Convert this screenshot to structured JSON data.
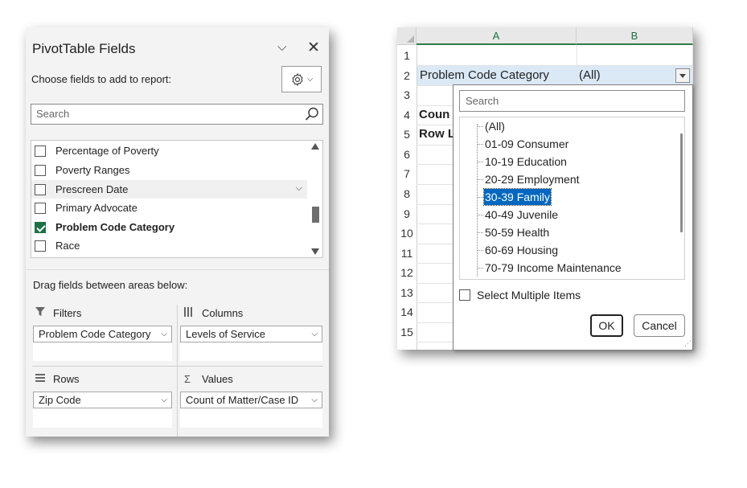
{
  "pane": {
    "title": "PivotTable Fields",
    "dropdown_glyph": "⌵",
    "close_glyph": "✕",
    "choose_label": "Choose fields to add to report:",
    "search_placeholder": "Search",
    "fields": [
      {
        "label": "Percentage of Poverty",
        "checked": false
      },
      {
        "label": "Poverty Ranges",
        "checked": false
      },
      {
        "label": "Prescreen Date",
        "checked": false
      },
      {
        "label": "Primary Advocate",
        "checked": false
      },
      {
        "label": "Problem Code Category",
        "checked": true
      },
      {
        "label": "Race",
        "checked": false
      }
    ],
    "drag_label": "Drag fields between areas below:",
    "areas": {
      "filters": {
        "title": "Filters",
        "value": "Problem Code Category"
      },
      "columns": {
        "title": "Columns",
        "value": "Levels of Service"
      },
      "rows": {
        "title": "Rows",
        "value": "Zip Code"
      },
      "values": {
        "title": "Values",
        "value": "Count of Matter/Case ID"
      }
    },
    "accent_color": "#1e7145"
  },
  "sheet": {
    "columns": [
      "A",
      "B"
    ],
    "rows": [
      "1",
      "2",
      "3",
      "4",
      "5",
      "6",
      "7",
      "8",
      "9",
      "10",
      "11",
      "12",
      "13",
      "14",
      "15"
    ],
    "a2": "Problem Code Category",
    "b2": "(All)",
    "a4": "Coun",
    "a5": "Row L"
  },
  "popup": {
    "search_placeholder": "Search",
    "items": [
      "(All)",
      "01-09 Consumer",
      "10-19 Education",
      "20-29 Employment",
      "30-39 Family",
      "40-49 Juvenile",
      "50-59 Health",
      "60-69 Housing",
      "70-79 Income Maintenance"
    ],
    "selected": "30-39 Family",
    "select_multiple_label": "Select Multiple Items",
    "ok_label": "OK",
    "cancel_label": "Cancel",
    "selection_color": "#0067c0"
  }
}
